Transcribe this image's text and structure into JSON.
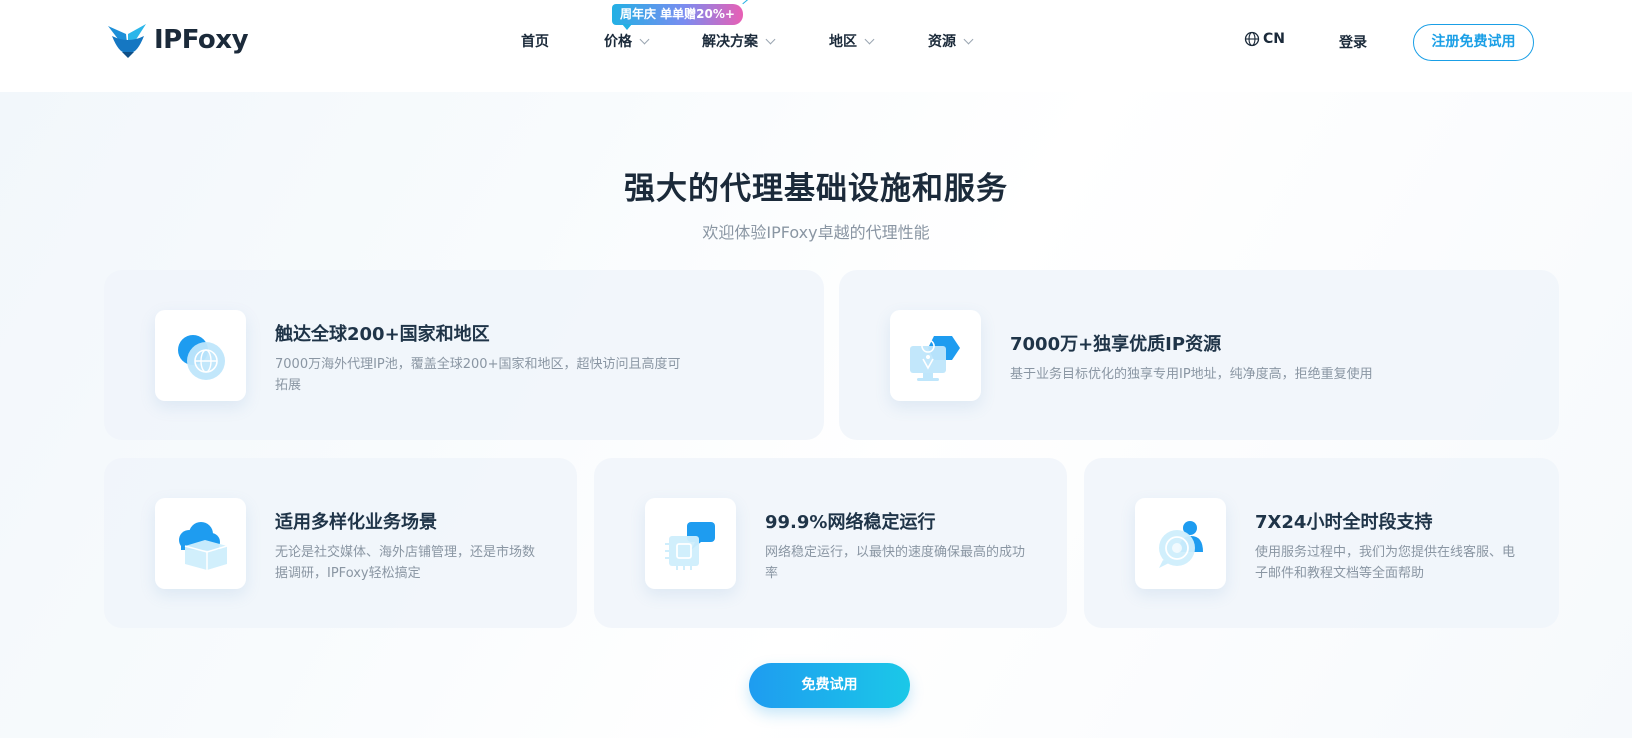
{
  "header": {
    "logo_text": "IPFoxy",
    "nav": [
      {
        "label": "首页"
      },
      {
        "label": "价格"
      },
      {
        "label": "解决方案"
      },
      {
        "label": "地区"
      },
      {
        "label": "资源"
      }
    ],
    "promo_badge": "周年庆 单单赠20%+",
    "lang_label": "CN",
    "login_label": "登录",
    "signup_label": "注册免费试用"
  },
  "section": {
    "title": "强大的代理基础设施和服务",
    "subtitle": "欢迎体验IPFoxy卓越的代理性能"
  },
  "features": [
    {
      "title": "触达全球200+国家和地区",
      "desc": "7000万海外代理IP池，覆盖全球200+国家和地区，超快访问且高度可拓展",
      "icon": "globe-icon"
    },
    {
      "title": "7000万+独享优质IP资源",
      "desc": "基于业务目标优化的独享专用IP地址，纯净度高，拒绝重复使用",
      "icon": "monitor-location-icon"
    },
    {
      "title": "适用多样化业务场景",
      "desc": "无论是社交媒体、海外店铺管理，还是市场数据调研，IPFoxy轻松搞定",
      "icon": "cloud-box-icon"
    },
    {
      "title": "99.9%网络稳定运行",
      "desc": "网络稳定运行，以最快的速度确保最高的成功率",
      "icon": "chip-chat-icon"
    },
    {
      "title": "7X24小时全时段支持",
      "desc": "使用服务过程中，我们为您提供在线客服、电子邮件和教程文档等全面帮助",
      "icon": "support-agent-icon"
    }
  ],
  "cta_label": "免费试用",
  "colors": {
    "accent": "#1a9fe6",
    "cta_start": "#1e9cf0",
    "cta_end": "#1bc8e8",
    "text_dark": "#1b2a3a",
    "text_muted": "#8a96a3"
  }
}
